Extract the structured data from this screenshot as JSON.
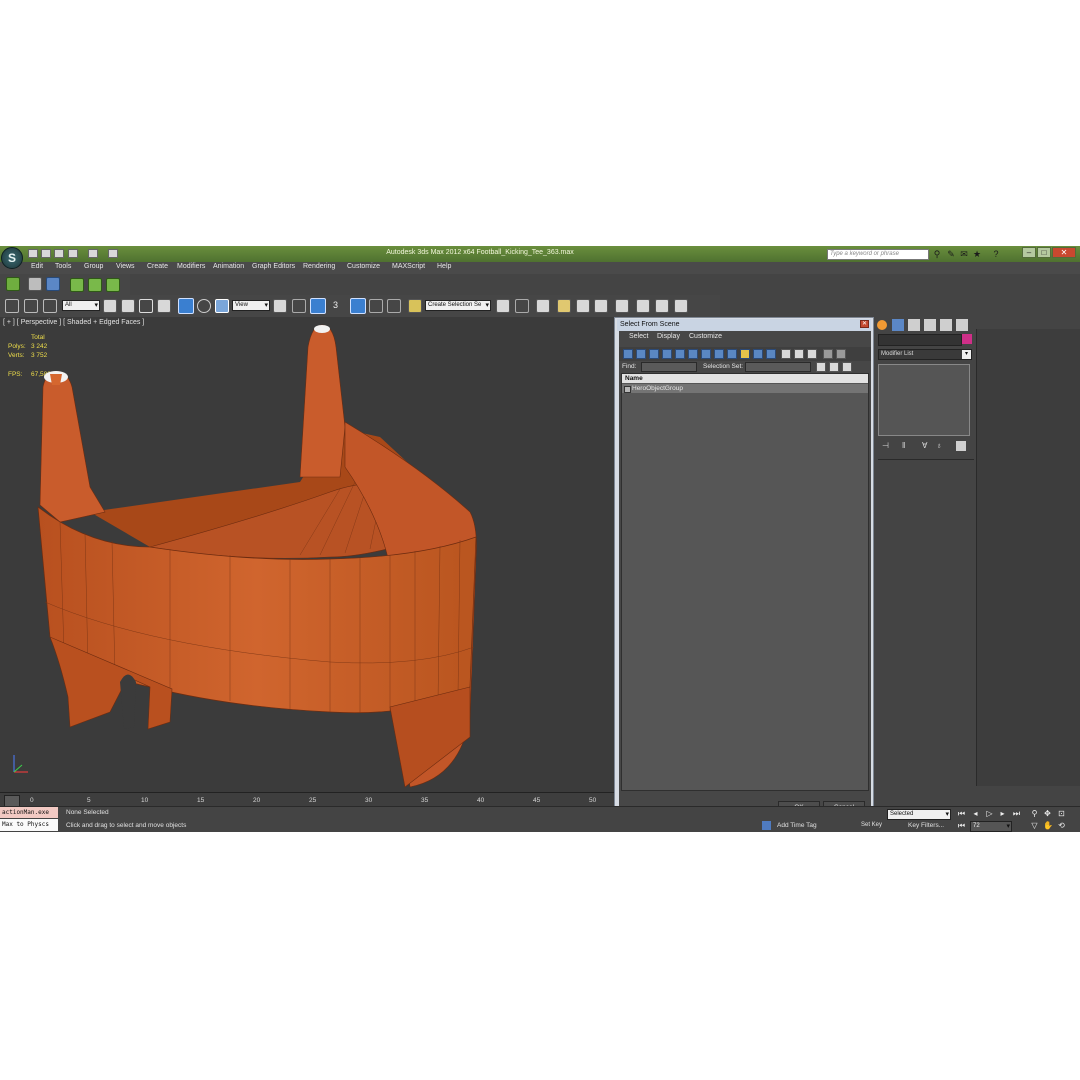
{
  "window": {
    "app_title": "Autodesk 3ds Max  2012 x64     Football_Kicking_Tee_363.max",
    "search_placeholder": "Type a keyword or phrase",
    "logo_letter": "S"
  },
  "menu": [
    "Edit",
    "Tools",
    "Group",
    "Views",
    "Create",
    "Modifiers",
    "Animation",
    "Graph Editors",
    "Rendering",
    "Customize",
    "MAXScript",
    "Help"
  ],
  "toolbar": {
    "filter_value": "All",
    "ref_coord_value": "View",
    "snap_label": "3",
    "selection_set_value": "Create Selection Se"
  },
  "viewport": {
    "label": "[ + ] [ Perspective ] [ Shaded + Edged Faces ]",
    "stats": {
      "total_label": "Total",
      "polys_label": "Polys:",
      "polys_value": "3 242",
      "verts_label": "Verts:",
      "verts_value": "3 752",
      "fps_label": "FPS:",
      "fps_value": "67,583"
    },
    "model_color": "#c95c2c"
  },
  "dialog": {
    "title": "Select From Scene",
    "menu": [
      "Select",
      "Display",
      "Customize"
    ],
    "find_label": "Find:",
    "selection_set_label": "Selection Set:",
    "column_header": "Name",
    "rows": [
      "HeroObjectGroup"
    ],
    "ok_label": "OK",
    "cancel_label": "Cancel"
  },
  "command_panel": {
    "modifier_list": "Modifier List",
    "swatch_color": "#cf2f88"
  },
  "timeline": {
    "ticks": [
      "0",
      "5",
      "10",
      "15",
      "20",
      "25",
      "30",
      "35",
      "40",
      "45",
      "50"
    ]
  },
  "status": {
    "maxscript_line1": "actionMan.exe",
    "maxscript_line2": "Max to Physcs",
    "selection": "None Selected",
    "prompt": "Click and drag to select and move objects",
    "add_time_tag": "Add Time Tag",
    "set_key": "Set Key",
    "key_filters": "Key Filters...",
    "key_mode_value": "Selected",
    "frame_value": "72"
  }
}
